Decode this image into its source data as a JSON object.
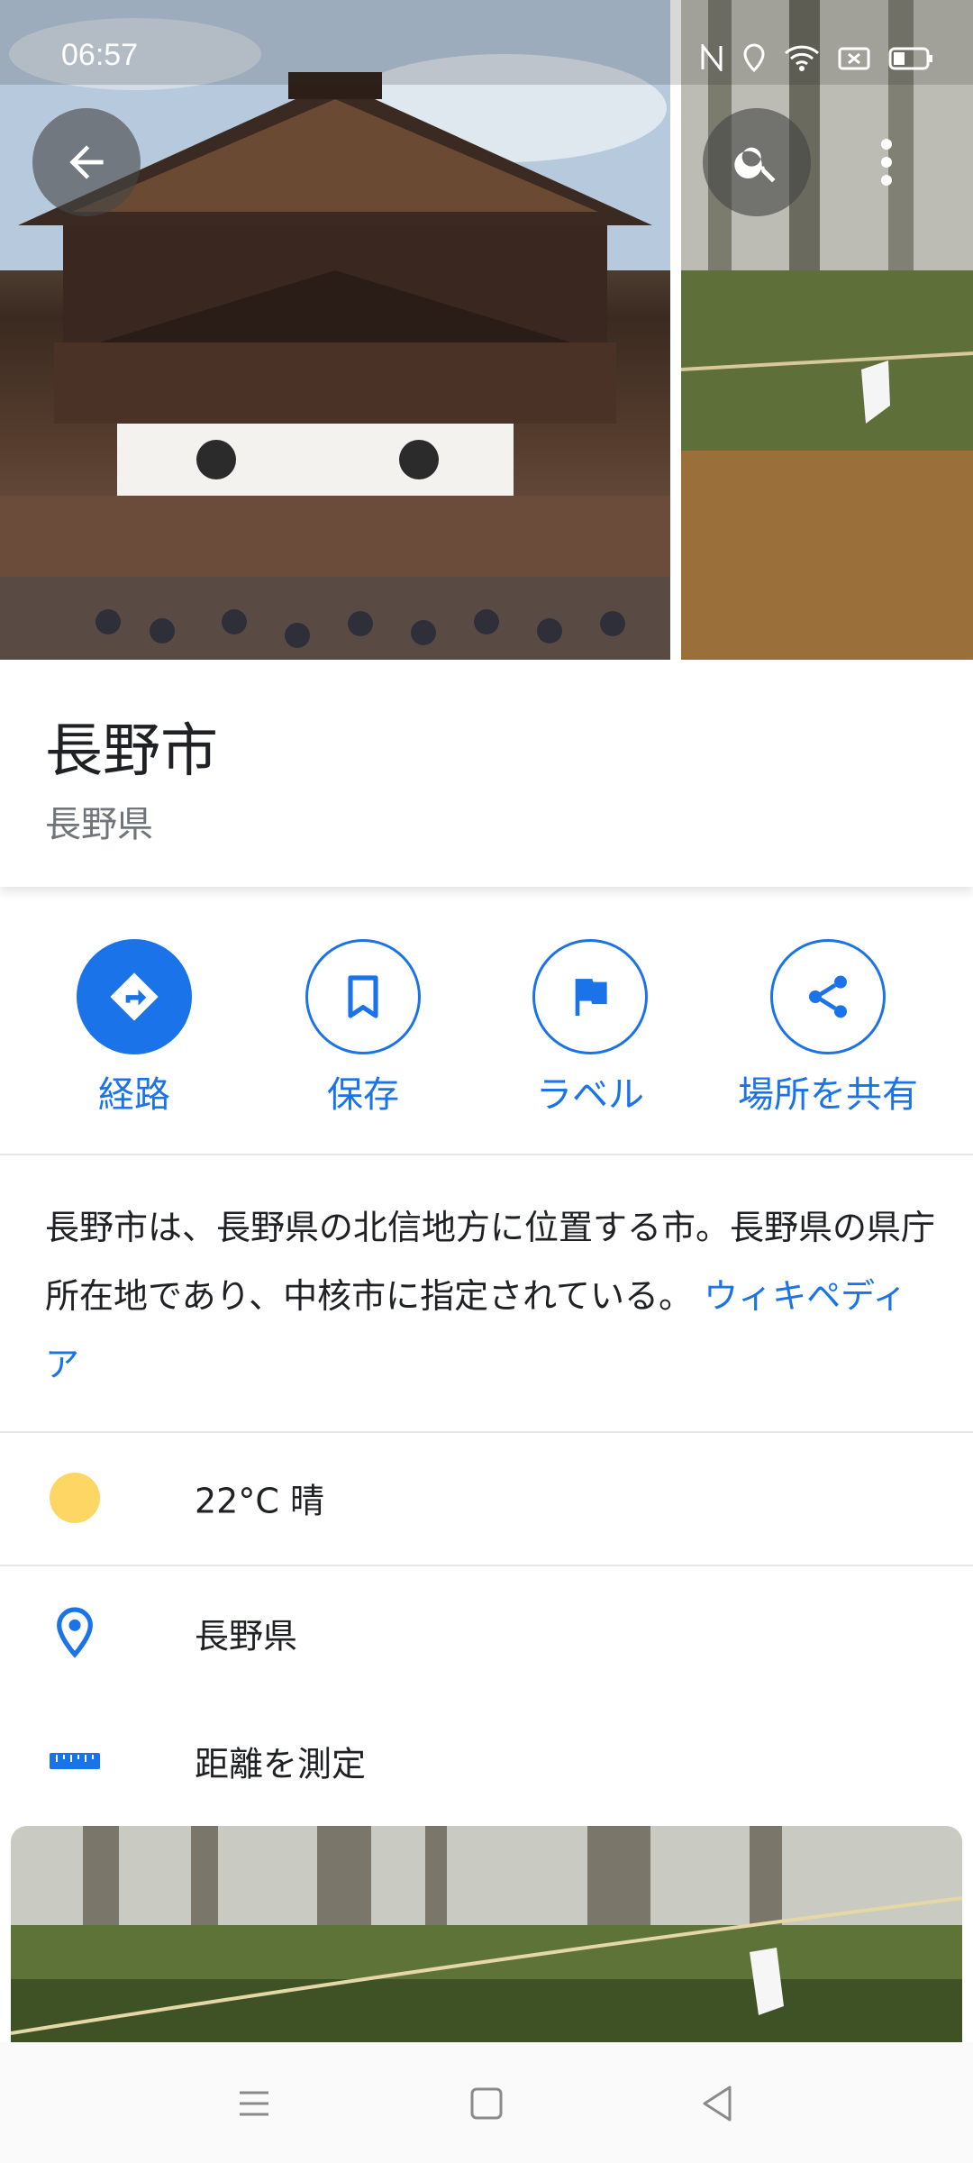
{
  "status_bar": {
    "time": "06:57"
  },
  "place": {
    "title": "長野市",
    "subtitle": "長野県"
  },
  "actions": [
    {
      "label": "経路",
      "icon": "directions-icon"
    },
    {
      "label": "保存",
      "icon": "bookmark-icon"
    },
    {
      "label": "ラベル",
      "icon": "flag-icon"
    },
    {
      "label": "場所を共有",
      "icon": "share-icon"
    }
  ],
  "description": {
    "text": "長野市は、長野県の北信地方に位置する市。長野県の県庁所在地であり、中核市に指定されている。",
    "source_link": "ウィキペディア"
  },
  "weather": {
    "text": "22°C 晴",
    "icon": "sun-icon"
  },
  "address": {
    "text": "長野県",
    "icon": "location-pin-icon"
  },
  "measure": {
    "text": "距離を測定",
    "icon": "ruler-icon"
  },
  "colors": {
    "accent": "#1a73e8",
    "sun": "#fdd663",
    "text_primary": "#202124",
    "text_secondary": "#70757a"
  }
}
